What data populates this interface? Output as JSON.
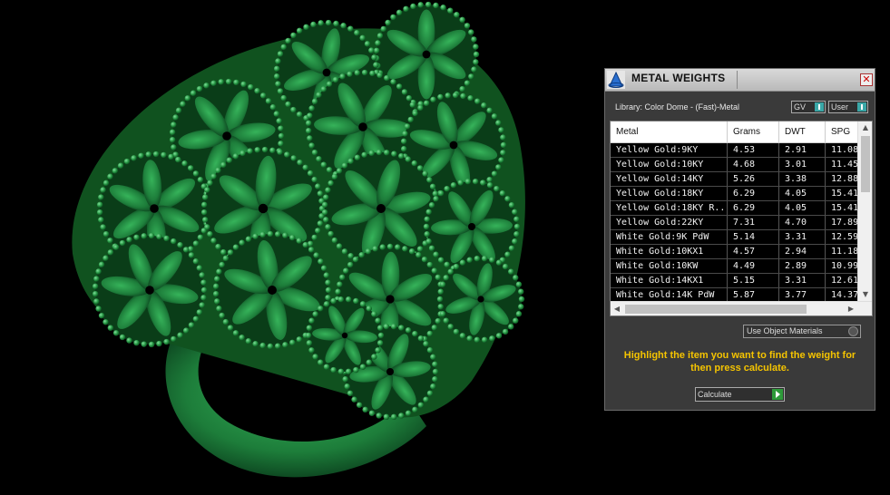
{
  "panel": {
    "title": "METAL WEIGHTS",
    "close_glyph": "✕",
    "library_label": "Library: Color Dome - (Fast)-Metal",
    "toggles": {
      "gv": "GV",
      "user": "User"
    },
    "columns": [
      "Metal",
      "Grams",
      "DWT",
      "SPG"
    ],
    "rows": [
      {
        "metal": "Yellow Gold:9KY",
        "grams": "4.53",
        "dwt": "2.91",
        "spg": "11.08"
      },
      {
        "metal": "Yellow Gold:10KY",
        "grams": "4.68",
        "dwt": "3.01",
        "spg": "11.45"
      },
      {
        "metal": "Yellow Gold:14KY",
        "grams": "5.26",
        "dwt": "3.38",
        "spg": "12.88"
      },
      {
        "metal": "Yellow Gold:18KY",
        "grams": "6.29",
        "dwt": "4.05",
        "spg": "15.41"
      },
      {
        "metal": "Yellow Gold:18KY R...",
        "grams": "6.29",
        "dwt": "4.05",
        "spg": "15.41"
      },
      {
        "metal": "Yellow Gold:22KY",
        "grams": "7.31",
        "dwt": "4.70",
        "spg": "17.89"
      },
      {
        "metal": "White Gold:9K PdW",
        "grams": "5.14",
        "dwt": "3.31",
        "spg": "12.59"
      },
      {
        "metal": "White Gold:10KX1",
        "grams": "4.57",
        "dwt": "2.94",
        "spg": "11.18"
      },
      {
        "metal": "White Gold:10KW",
        "grams": "4.49",
        "dwt": "2.89",
        "spg": "10.99"
      },
      {
        "metal": "White Gold:14KX1",
        "grams": "5.15",
        "dwt": "3.31",
        "spg": "12.61"
      },
      {
        "metal": "White Gold:14K PdW",
        "grams": "5.87",
        "dwt": "3.77",
        "spg": "14.37"
      }
    ],
    "use_object_materials": "Use Object Materials",
    "hint": "Highlight the item you want to find the weight for then press calculate.",
    "calculate_label": "Calculate"
  },
  "colors": {
    "accent_toggle": "#3aa7a7",
    "hint_text": "#f5c400",
    "play_button": "#2e9a3a",
    "ring_green": "#1f8a3c"
  }
}
